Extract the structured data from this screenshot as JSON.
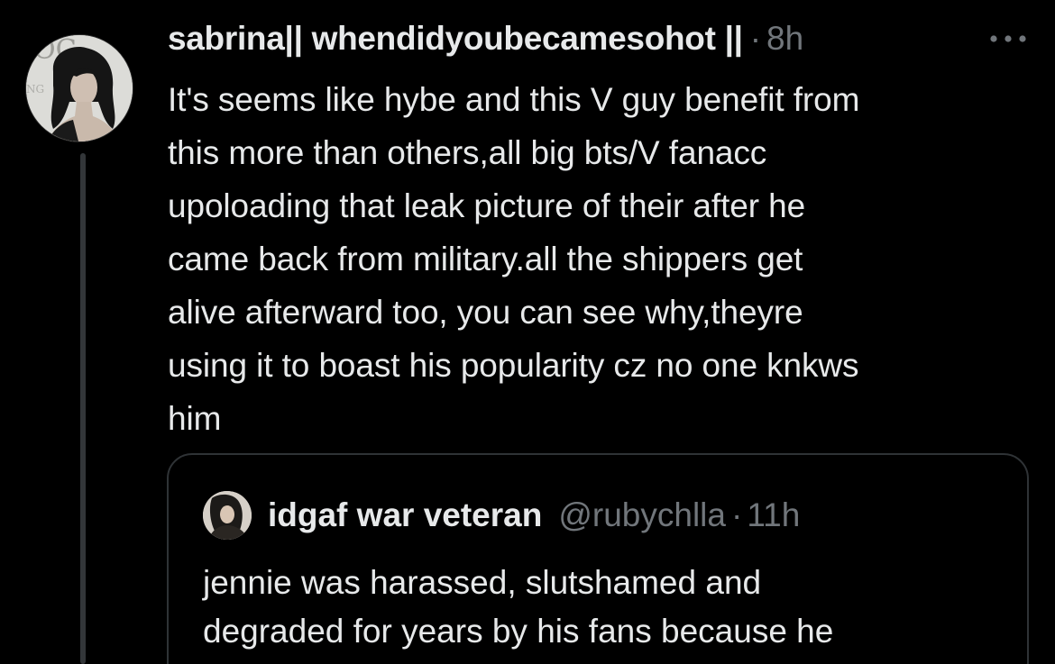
{
  "tweet": {
    "display_name": "sabrina|| whendidyoubecamesohot ||",
    "separator": "·",
    "time": "8h",
    "more_icon": "more-horizontal-icon",
    "text": "It's seems like hybe and this V guy benefit from\nthis more than others,all big bts/V fanacc\nupoloading that leak picture of their after he\ncame back from military.all the shippers get\nalive afterward too, you can see why,theyre\nusing it to boast his popularity cz no one knkws\nhim"
  },
  "quote": {
    "display_name": "idgaf war veteran",
    "handle": "@rubychlla",
    "separator": "·",
    "time": "11h",
    "text": "jennie was harassed, slutshamed and\ndegraded for years by his fans because he"
  },
  "colors": {
    "background": "#000000",
    "primary_text": "#e7e9ea",
    "secondary_text": "#71767b",
    "border": "#2f3336",
    "thread_line": "#333639"
  }
}
